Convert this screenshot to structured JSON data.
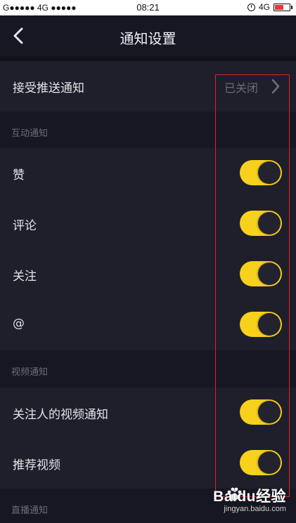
{
  "status_bar": {
    "left": "G●●●●● 4G ●●●●●",
    "time": "08:21",
    "network": "4G",
    "battery_level": 0.55,
    "battery_color": "#e23a3a"
  },
  "header": {
    "title": "通知设置",
    "back_icon": "chevron-left-icon"
  },
  "push": {
    "label": "接受推送通知",
    "value": "已关闭",
    "chevron_icon": "chevron-right-icon"
  },
  "sections": {
    "interaction": {
      "title": "互动通知"
    },
    "video": {
      "title": "视频通知"
    },
    "live": {
      "title": "直播通知"
    }
  },
  "items": {
    "like": {
      "label": "赞",
      "on": true
    },
    "comment": {
      "label": "评论",
      "on": true
    },
    "follow": {
      "label": "关注",
      "on": true
    },
    "mention": {
      "label": "@",
      "on": true
    },
    "followed_video": {
      "label": "关注人的视频通知",
      "on": true
    },
    "recommended_video": {
      "label": "推荐视频",
      "on": true
    }
  },
  "colors": {
    "background": "#171723",
    "row": "#1f1f2b",
    "toggle_on": "#f8d11c",
    "highlight": "#e02222"
  },
  "watermark": {
    "brand": "Baidu经验",
    "url": "jingyan.baidu.com"
  }
}
